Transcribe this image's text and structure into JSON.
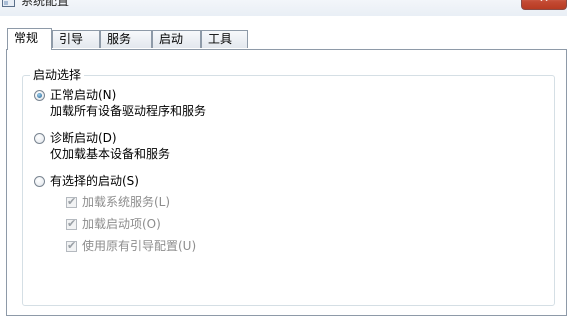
{
  "window": {
    "title": "系统配置",
    "close_glyph": "✕"
  },
  "tabs": [
    {
      "label": "常规",
      "active": true
    },
    {
      "label": "引导",
      "active": false
    },
    {
      "label": "服务",
      "active": false
    },
    {
      "label": "启动",
      "active": false
    },
    {
      "label": "工具",
      "active": false
    }
  ],
  "startup_group": {
    "legend": "启动选择",
    "options": [
      {
        "label": "正常启动(N)",
        "description": "加载所有设备驱动程序和服务",
        "selected": true
      },
      {
        "label": "诊断启动(D)",
        "description": "仅加载基本设备和服务",
        "selected": false
      },
      {
        "label": "有选择的启动(S)",
        "description": "",
        "selected": false
      }
    ],
    "selective_items": [
      {
        "label": "加载系统服务(L)",
        "checked": true,
        "enabled": false
      },
      {
        "label": "加载启动项(O)",
        "checked": true,
        "enabled": false
      },
      {
        "label": "使用原有引导配置(U)",
        "checked": true,
        "enabled": false
      }
    ]
  },
  "colors": {
    "tab_border": "#8e9aa8",
    "group_border": "#d5dfe5",
    "disabled_text": "#8d8d8d",
    "close_button": "#c34a33"
  },
  "icons": {
    "title_icon": "system-config-icon",
    "close_icon": "close-icon"
  }
}
